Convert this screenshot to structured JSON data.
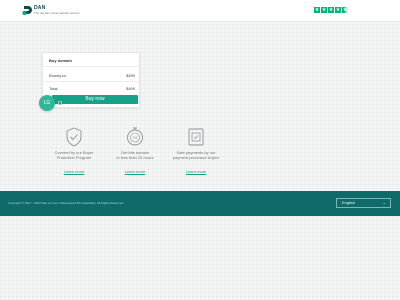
{
  "header": {
    "brand": "DAN",
    "tagline": "The domain name transfer service",
    "trustpilot_stars": 4.5
  },
  "buy_card": {
    "title": "Buy domain",
    "domain_name": "Boosty.co",
    "domain_price": "$499",
    "total_label": "Total",
    "total_price": "$499",
    "buy_button": "Buy now"
  },
  "chat_bubble": {
    "initials": "LG"
  },
  "features": [
    {
      "icon": "shield-check-icon",
      "line1": "Covered by our Buyer",
      "line2": "Protection Program",
      "link": "Learn more"
    },
    {
      "icon": "clock-24h-icon",
      "line1": "Get this domain",
      "line2": "in less than 24 hours",
      "link": "Learn more"
    },
    {
      "icon": "secure-payment-icon",
      "line1": "Safe payments by our",
      "line2": "payment processor Adyen",
      "link": "Learn more"
    }
  ],
  "footer": {
    "copyright": "Copyright © 2017 - 2024 Dan.com an Undeveloped BV subsidiary. All Rights Reserved.",
    "language": "English"
  },
  "colors": {
    "accent": "#18a189",
    "footer_bg": "#0e6b6a",
    "trustpilot": "#00b67a"
  }
}
